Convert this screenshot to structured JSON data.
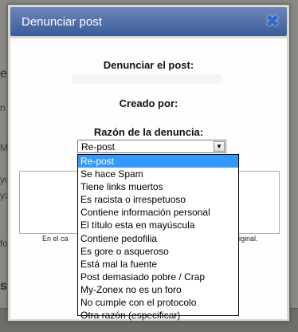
{
  "dialog": {
    "title": "Denunciar post",
    "report_label": "Denunciar el post:",
    "creator_label": "Creado por:",
    "reason_label": "Razón de la denuncia:",
    "select_value": "Re-post",
    "hint_left": "En el ca",
    "hint_right": "original."
  },
  "options": [
    "Re-post",
    "Se hace Spam",
    "Tiene links muertos",
    "Es racista o irrespetuoso",
    "Contiene información personal",
    "El título esta en mayúscula",
    "Contiene pedofilia",
    "Es gore o asqueroso",
    "Está mal la fuente",
    "Post demasiado pobre / Crap",
    "My-Zonex no es un foro",
    "No cumple con el protocolo",
    "Otra razón (especificar)"
  ],
  "background": {
    "text_top": "e t",
    "text_bottom": "s",
    "frag_1": "n",
    "frag_2": "M",
    "frag_3": "yo",
    "frag_4": "yz",
    "frag_5": "fo"
  }
}
